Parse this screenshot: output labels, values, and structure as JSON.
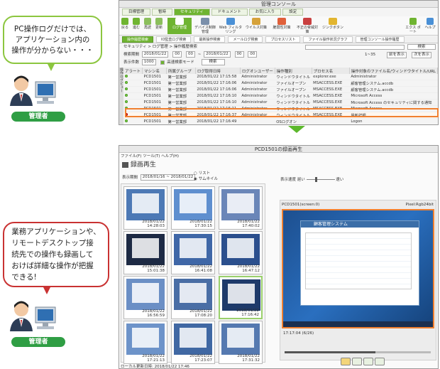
{
  "callout_top": {
    "lines": [
      "PC操作ログだけでは、",
      "アプリケーション内の",
      "操作が分からない・・・"
    ]
  },
  "callout_bottom": {
    "lines": [
      "業務アプリケーションや、",
      "リモートデスクトップ接",
      "続先での操作も録画して",
      "おけば詳細な操作が把握",
      "できる!"
    ]
  },
  "badge_top": "管理者",
  "badge_bottom": "管理者",
  "console": {
    "title": "管理コンソール",
    "top_tabs": [
      "目標管理",
      "暫時",
      "セキュリティ",
      "ドキュメント",
      "お気に入り",
      "設定"
    ],
    "active_top_tab": "セキュリティ",
    "ribbon": [
      "戻る",
      "進む",
      "再読",
      "更新",
      "ログ管理",
      "デバイス制御 管理",
      "Web フィルタリング",
      "ウイルス対策",
      "脆弱性対策",
      "不正の脅威対策",
      "ジンクボタン"
    ],
    "right_btns": [
      "エクス ポート",
      "ヘルプ"
    ],
    "sub_tabs": [
      "操作履歴検索",
      "IO監査ログ検索",
      "最新操作検索",
      "メールログ検索",
      "プロセスリスト",
      "ファイル操作状況グラフ",
      "管理コンソール操作履歴"
    ],
    "breadcrumb": "セキュリティ > ログ管理 > 操作履歴検索",
    "search_btn": "検索",
    "filter1": {
      "label": "検索期間",
      "from": "2018/01/22",
      "h1": "00",
      "m1": "00",
      "to": "2018/01/22",
      "h2": "00",
      "m2": "00"
    },
    "filter2": {
      "label": "表示件数",
      "count": "1000",
      "mode": "高速検索モード",
      "go": "検索"
    },
    "paging": "1~35",
    "prev": "前を表示",
    "next": "次を表示",
    "sidebar_tab": "操作ログビュー",
    "columns": [
      "アラート",
      "マシン名",
      "所属グループ",
      "ログ取得日時",
      "ログオンユーザー",
      "操作種別",
      "プロセス名",
      "操作対象のファイル名/ウィンドウタイトル/URL"
    ],
    "rows": [
      [
        "green",
        "PCD1501",
        "第一営業部",
        "2018/01/22 17:15:58",
        "Administrator",
        "ウィンドウタイトル",
        "explorer.exe",
        "Administrator"
      ],
      [
        "green",
        "PCD1501",
        "第一営業部",
        "2018/01/22 17:16:06",
        "Administrator",
        "ファイルオープン",
        "MSACCESS.EXE",
        "顧客管理システム.accdb"
      ],
      [
        "green",
        "PCD1501",
        "第一営業部",
        "2018/01/22 17:16:06",
        "Administrator",
        "ファイルオープン",
        "MSACCESS.EXE",
        "顧客管理システム.accdb"
      ],
      [
        "green",
        "PCD1501",
        "第一営業部",
        "2018/01/22 17:16:10",
        "Administrator",
        "ウィンドウタイトル",
        "MSACCESS.EXE",
        "Microsoft Access"
      ],
      [
        "green",
        "PCD1501",
        "第一営業部",
        "2018/01/22 17:16:10",
        "Administrator",
        "ウィンドウタイトル",
        "MSACCESS.EXE",
        "Microsoft Access のセキュリティに関する通知"
      ],
      [
        "green",
        "PCD1501",
        "第一営業部",
        "2018/01/22 17:16:11",
        "Administrator",
        "ウィンドウタイトル",
        "MSACCESS.EXE",
        "Microsoft Access"
      ],
      [
        "red",
        "PCD1501",
        "第一営業部",
        "2018/01/22 17:16:37",
        "Administrator",
        "ウィンドウタイトル",
        "MSACCESS.EXE",
        "最新詳細"
      ],
      [
        "green",
        "PCD1501",
        "第一営業部",
        "2018/01/22 17:16:49",
        "",
        "OSログオン",
        "",
        "Logon"
      ]
    ]
  },
  "player": {
    "title": "PCD1501の録画再生",
    "menu": [
      "ファイル(F)",
      "ツール(T)",
      "ヘルプ(H)"
    ],
    "heading": "録画再生",
    "period_label": "表示期間",
    "period_value": "2018/01/16 ~ 2018/01/22",
    "view_list": "リスト",
    "view_thumb": "サムネイル",
    "speed_label": "表示速度",
    "speed_slow": "遅い",
    "speed_fast": "速い",
    "machine": "PCD1501(screen:0)",
    "pixel": "Pixel:Rgb24bit",
    "time": "17:17:04 (6/26)",
    "app_title": "顧客管理システム",
    "updated": "ローカル更新日時: 2018/01/22 17:46",
    "thumbs": [
      "2018/01/22 14:28:03",
      "2018/01/22 17:30:15",
      "2018/01/22 17:40:02",
      "2018/01/22 15:01:38",
      "2018/01/22 16:41:08",
      "2018/01/22 16:47:12",
      "2018/01/22 16:56:59",
      "2018/01/22 17:08:20",
      "2018/01/22 17:16:42",
      "2018/01/22 17:21:13",
      "2018/01/22 17:23:07",
      "2018/01/22 17:31:32"
    ],
    "active_thumb": 8
  }
}
